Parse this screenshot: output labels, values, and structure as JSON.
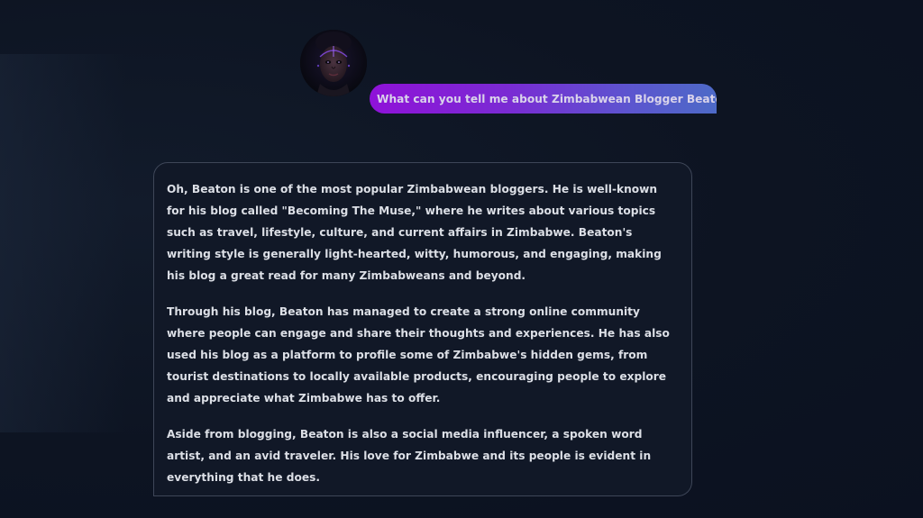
{
  "conversation": {
    "user_message": "What can you tell me about Zimbabwean Blogger Beaton",
    "assistant_paragraphs": [
      "Oh, Beaton is one of the most popular Zimbabwean bloggers. He is well-known for his blog called \"Becoming The Muse,\" where he writes about various topics such as travel, lifestyle, culture, and current affairs in Zimbabwe. Beaton's writing style is generally light-hearted, witty, humorous, and engaging, making his blog a great read for many Zimbabweans and beyond.",
      "Through his blog, Beaton has managed to create a strong online community where people can engage and share their thoughts and experiences. He has also used his blog as a platform to profile some of Zimbabwe's hidden gems, from tourist destinations to locally available products, encouraging people to explore and appreciate what Zimbabwe has to offer.",
      "Aside from blogging, Beaton is also a social media influencer, a spoken word artist, and an avid traveler. His love for Zimbabwe and its people is evident in everything that he does."
    ]
  },
  "theme": {
    "background": "#0d1422",
    "user_bubble_gradient": [
      "#8f12d8",
      "#4d6ac7"
    ],
    "assistant_bubble_border": "#3e4658"
  },
  "icons": {
    "avatar": "ai-persona-avatar"
  }
}
